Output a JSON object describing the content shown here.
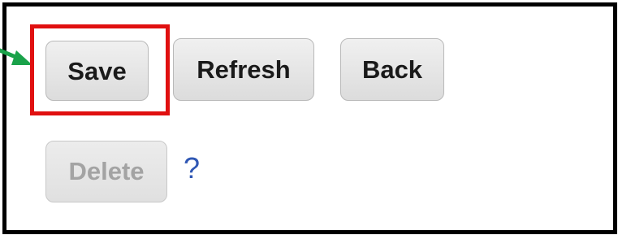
{
  "buttons": {
    "save": "Save",
    "refresh": "Refresh",
    "back": "Back",
    "delete": "Delete"
  },
  "help": {
    "symbol": "?"
  },
  "annotations": {
    "highlight_color": "#e01010",
    "arrow_color": "#1aa24a",
    "help_color": "#2f57b4"
  }
}
